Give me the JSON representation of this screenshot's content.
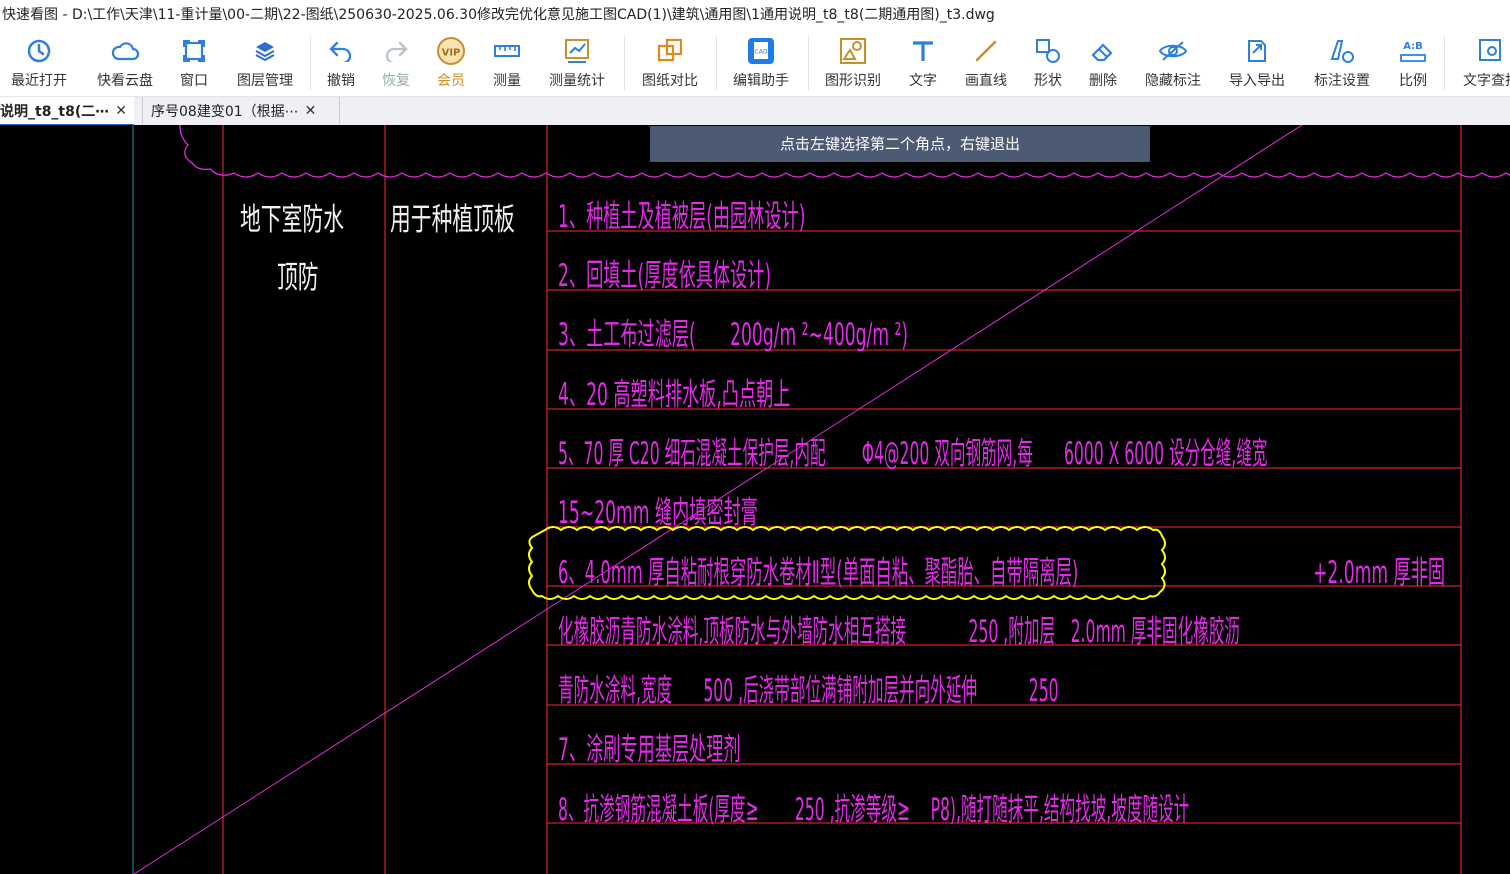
{
  "window": {
    "title": "快速看图 - D:\\工作\\天津\\11-重计量\\00-二期\\22-图纸\\250630-2025.06.30修改完优化意见施工图CAD(1)\\建筑\\通用图\\1通用说明_t8_t8(二期通用图)_t3.dwg"
  },
  "toolbar": {
    "items": [
      {
        "label": "最近打开",
        "icon": "recent-open-icon"
      },
      {
        "label": "快看云盘",
        "icon": "cloud-icon"
      },
      {
        "label": "窗口",
        "icon": "window-icon"
      },
      {
        "label": "图层管理",
        "icon": "layers-icon"
      },
      {
        "label": "撤销",
        "icon": "undo-icon"
      },
      {
        "label": "恢复",
        "icon": "redo-icon"
      },
      {
        "label": "会员",
        "icon": "vip-icon"
      },
      {
        "label": "测量",
        "icon": "measure-icon"
      },
      {
        "label": "测量统计",
        "icon": "measure-stats-icon"
      },
      {
        "label": "图纸对比",
        "icon": "compare-icon"
      },
      {
        "label": "编辑助手",
        "icon": "edit-assistant-icon"
      },
      {
        "label": "图形识别",
        "icon": "shape-recognize-icon"
      },
      {
        "label": "文字",
        "icon": "text-icon"
      },
      {
        "label": "画直线",
        "icon": "line-icon"
      },
      {
        "label": "形状",
        "icon": "shape-icon"
      },
      {
        "label": "删除",
        "icon": "eraser-icon"
      },
      {
        "label": "隐藏标注",
        "icon": "hide-annotation-icon"
      },
      {
        "label": "导入导出",
        "icon": "import-export-icon"
      },
      {
        "label": "标注设置",
        "icon": "annotation-settings-icon"
      },
      {
        "label": "比例",
        "icon": "scale-icon"
      },
      {
        "label": "文字查找",
        "icon": "text-search-icon"
      }
    ],
    "vip_text": "VIP",
    "cad_text": "CAD",
    "scale_text": "A:B"
  },
  "tabs": [
    {
      "label": "说明_t8_t8(二⋯",
      "active": true,
      "close": "✕"
    },
    {
      "label": "序号08建变01（根据⋯",
      "active": false,
      "close": "✕"
    }
  ],
  "canvas": {
    "hint": "点击左键选择第二个角点，右键退出",
    "left_col_1": "地下室防水",
    "left_col_2": "顶防",
    "mid_col": "用于种植顶板",
    "rows": [
      "1、种植土及植被层(由园林设计)",
      "2、回填土(厚度依具体设计)",
      "3、土工布过滤层(　　200g/m ²~400g/m ²)",
      "4、20 高塑料排水板,凸点朝上",
      "5、70 厚 C20 细石混凝土保护层,内配　　 Φ4@200 双向钢筋网,每　　6000 X 6000 设分仓缝,缝宽",
      "15~20mm  缝内填密封膏",
      "6、4.0mm 厚自粘耐根穿防水卷材Ⅱ型(单面自粘、聚酯胎、自带隔离层)",
      "化橡胶沥青防水涂料,顶板防水与外墙防水相互搭接　　　　250 ,附加层　2.0mm 厚非固化橡胶沥",
      "青防水涂料,宽度　　500 ,后浇带部位满铺附加层并向外延伸　　　 250",
      "7、涂刷专用基层处理剂",
      "8、抗渗钢筋混凝土板(厚度≥　　 250 ,抗渗等级≥　 P8),随打随抹平,结构找坡,坡度随设计"
    ],
    "row6_tail": "+2.0mm 厚非固",
    "colors": {
      "background": "#000000",
      "grid_red": "#ff2a2a",
      "text_magenta": "#e22be6",
      "text_white": "#f2f2f2",
      "cloud_yellow": "#ffff00",
      "revision_cloud_magenta": "#e22be6",
      "diagonal_line": "#e22be6",
      "border_teal": "#3a8f9a"
    }
  }
}
